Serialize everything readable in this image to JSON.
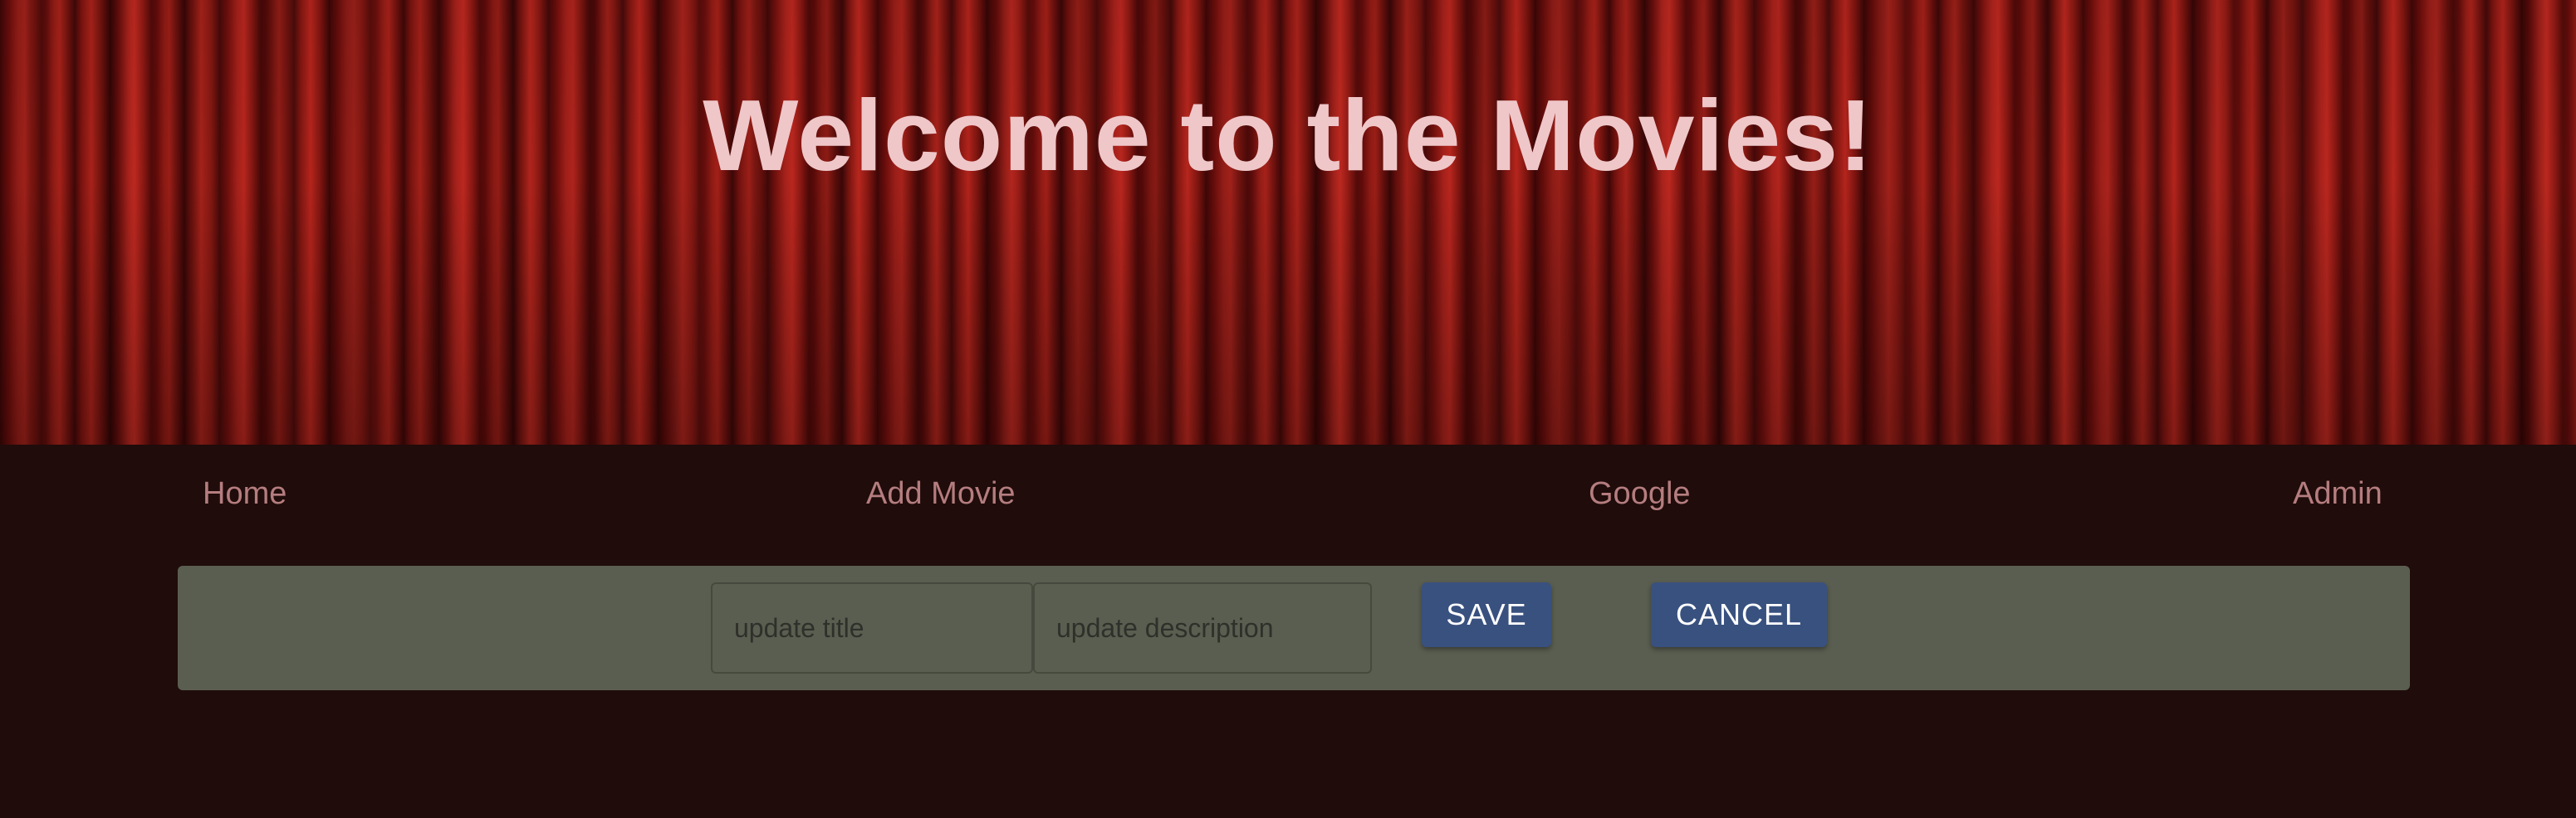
{
  "hero": {
    "title": "Welcome to the Movies!"
  },
  "nav": {
    "items": [
      {
        "label": "Home"
      },
      {
        "label": "Add Movie"
      },
      {
        "label": "Google"
      },
      {
        "label": "Admin"
      }
    ]
  },
  "edit_form": {
    "title_placeholder": "update title",
    "title_value": "",
    "description_placeholder": "update description",
    "description_value": "",
    "save_label": "SAVE",
    "cancel_label": "CANCEL"
  },
  "colors": {
    "background": "#1f0c0b",
    "title_text": "#efc7c9",
    "nav_link": "#b57d7f",
    "panel": "#5a5e50",
    "button": "#39517f"
  }
}
